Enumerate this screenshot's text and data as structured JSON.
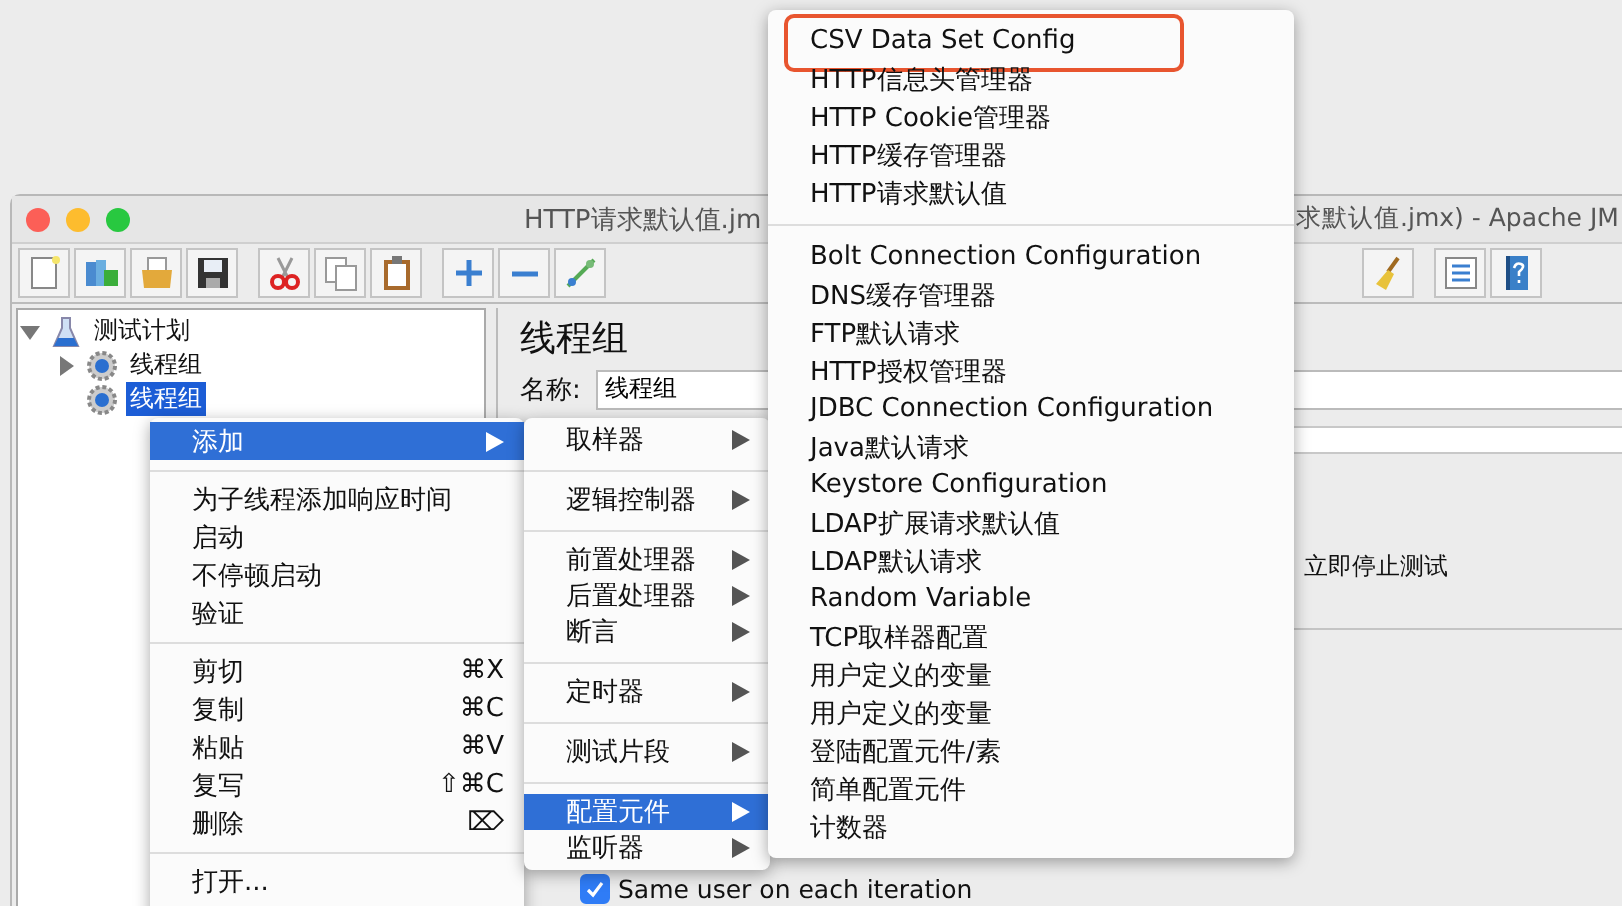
{
  "window": {
    "title_left": "HTTP请求默认值.jm",
    "title_right": "求默认值.jmx) - Apache JM"
  },
  "tree": [
    {
      "label": "测试计划",
      "expanded": true,
      "selected": false,
      "children": [
        {
          "label": "线程组",
          "expanded": false,
          "selected": false
        },
        {
          "label": "线程组",
          "selected": true
        }
      ]
    }
  ],
  "panel": {
    "heading": "线程组",
    "name_label": "名称:",
    "name_value": "线程组",
    "option_label": "立即停止测试",
    "checkbox": {
      "label": "Same user on each iteration",
      "checked": true
    }
  },
  "context_menu": {
    "groups": [
      [
        {
          "label": "添加",
          "submenu": true,
          "selected": true
        }
      ],
      [
        {
          "label": "为子线程添加响应时间",
          "selected": false
        },
        {
          "label": "启动",
          "selected": false
        },
        {
          "label": "不停顿启动",
          "selected": false
        },
        {
          "label": "验证",
          "selected": false
        }
      ],
      [
        {
          "label": "剪切",
          "shortcut": "⌘X",
          "selected": false
        },
        {
          "label": "复制",
          "shortcut": "⌘C",
          "selected": false
        },
        {
          "label": "粘贴",
          "shortcut": "⌘V",
          "selected": false
        },
        {
          "label": "复写",
          "shortcut": "⇧⌘C",
          "selected": false
        },
        {
          "label": "删除",
          "shortcut": "⌦",
          "selected": false
        }
      ],
      [
        {
          "label": "打开...",
          "selected": false
        }
      ]
    ]
  },
  "add_menu": {
    "groups": [
      [
        {
          "label": "取样器",
          "submenu": true,
          "selected": false
        }
      ],
      [
        {
          "label": "逻辑控制器",
          "submenu": true,
          "selected": false
        }
      ],
      [
        {
          "label": "前置处理器",
          "submenu": true,
          "selected": false
        },
        {
          "label": "后置处理器",
          "submenu": true,
          "selected": false
        },
        {
          "label": "断言",
          "submenu": true,
          "selected": false
        }
      ],
      [
        {
          "label": "定时器",
          "submenu": true,
          "selected": false
        }
      ],
      [
        {
          "label": "测试片段",
          "submenu": true,
          "selected": false
        }
      ],
      [
        {
          "label": "配置元件",
          "submenu": true,
          "selected": true
        },
        {
          "label": "监听器",
          "submenu": true,
          "selected": false
        }
      ]
    ]
  },
  "config_menu": {
    "groups": [
      [
        {
          "label": "CSV Data Set Config",
          "selected": false,
          "highlighted": true
        },
        {
          "label": "HTTP信息头管理器",
          "selected": false
        },
        {
          "label": "HTTP Cookie管理器",
          "selected": false
        },
        {
          "label": "HTTP缓存管理器",
          "selected": false
        },
        {
          "label": "HTTP请求默认值",
          "selected": false
        }
      ],
      [
        {
          "label": "Bolt Connection Configuration",
          "selected": false
        },
        {
          "label": "DNS缓存管理器",
          "selected": false
        },
        {
          "label": "FTP默认请求",
          "selected": false
        },
        {
          "label": "HTTP授权管理器",
          "selected": false
        },
        {
          "label": "JDBC Connection Configuration",
          "selected": false
        },
        {
          "label": "Java默认请求",
          "selected": false
        },
        {
          "label": "Keystore Configuration",
          "selected": false
        },
        {
          "label": "LDAP扩展请求默认值",
          "selected": false
        },
        {
          "label": "LDAP默认请求",
          "selected": false
        },
        {
          "label": "Random Variable",
          "selected": false
        },
        {
          "label": "TCP取样器配置",
          "selected": false
        },
        {
          "label": "用户定义的变量",
          "selected": false
        },
        {
          "label": "用户定义的变量",
          "selected": false
        },
        {
          "label": "登陆配置元件/素",
          "selected": false
        },
        {
          "label": "简单配置元件",
          "selected": false
        },
        {
          "label": "计数器",
          "selected": false
        }
      ]
    ]
  }
}
